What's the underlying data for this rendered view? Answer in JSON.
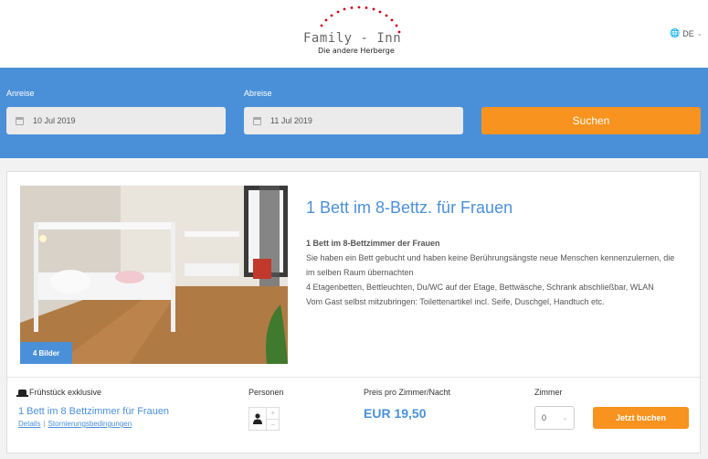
{
  "header": {
    "logo_title": "Family - Inn",
    "logo_subtitle": "Die andere Herberge",
    "language": "DE"
  },
  "search": {
    "arrival_label": "Anreise",
    "arrival_value": "10 Jul 2019",
    "departure_label": "Abreise",
    "departure_value": "11 Jul 2019",
    "search_button": "Suchen"
  },
  "room": {
    "image_badge": "4 Bilder",
    "title": "1 Bett im 8-Bettz. für Frauen",
    "desc_heading": "1 Bett im 8-Bettzimmer der Frauen",
    "desc_lines": [
      "Sie haben ein Bett gebucht und haben keine Berührungsängste neue Menschen kennenzulernen, die im selben Raum übernachten",
      "4 Etagenbetten, Bettleuchten, Du/WC auf der Etage, Bettwäsche, Schrank abschließbar, WLAN",
      "Vom Gast selbst mitzubringen: Toilettenartikel incl. Seife, Duschgel, Handtuch etc."
    ],
    "breakfast": "Frühstück exklusive",
    "room_link": "1 Bett im 8 Bettzimmer für Frauen",
    "details_link": "Details",
    "cancellation_link": "Stornierungsbedingungen",
    "persons_label": "Personen",
    "price_label": "Preis pro Zimmer/Nacht",
    "price": "EUR 19,50",
    "rooms_label": "Zimmer",
    "rooms_value": "0",
    "book_button": "Jetzt buchen"
  },
  "colors": {
    "accent_blue": "#4a90d9",
    "accent_orange": "#f7931e",
    "logo_dots": "#d0021b"
  },
  "icons": [
    "globe-icon",
    "calendar-icon",
    "hat-icon",
    "person-icon",
    "plus-icon",
    "minus-icon",
    "chevron-down-icon"
  ]
}
